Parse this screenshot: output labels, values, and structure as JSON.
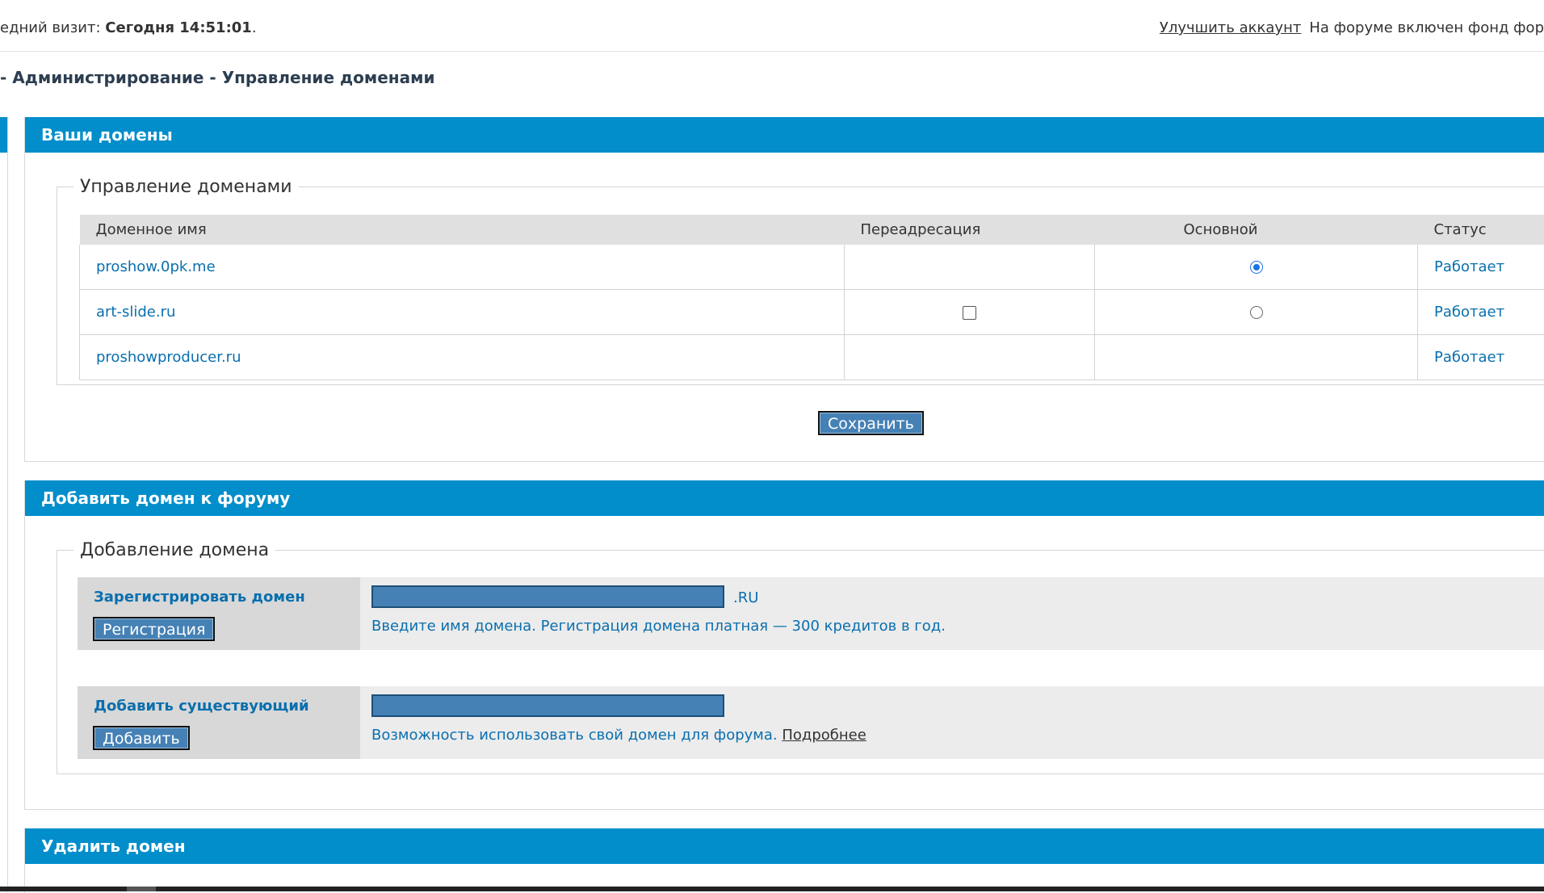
{
  "topbar": {
    "last_visit_label": "едний визит:",
    "last_visit_value": "Сегодня 14:51:01",
    "upgrade_link": "Улучшить аккаунт",
    "notice": "На форуме включен фонд фор"
  },
  "breadcrumb": "- Администрирование - Управление доменами",
  "your_domains": {
    "title": "Ваши домены",
    "legend": "Управление доменами",
    "columns": [
      "Доменное имя",
      "Переадресация",
      "Основной",
      "Статус"
    ],
    "rows": [
      {
        "domain": "proshow.0pk.me",
        "redirect": null,
        "primary": true,
        "status": "Работает"
      },
      {
        "domain": "art-slide.ru",
        "redirect": false,
        "primary": false,
        "status": "Работает"
      },
      {
        "domain": "proshowproducer.ru",
        "redirect": null,
        "primary": null,
        "status": "Работает"
      }
    ],
    "save_button": "Сохранить"
  },
  "add_domain": {
    "title": "Добавить домен к форуму",
    "legend": "Добавление домена",
    "register": {
      "label": "Зарегистрировать домен",
      "button": "Регистрация",
      "input_value": "",
      "suffix": ".RU",
      "hint": "Введите имя домена. Регистрация домена платная — 300 кредитов в год."
    },
    "existing": {
      "label": "Добавить существующий",
      "button": "Добавить",
      "input_value": "",
      "hint": "Возможность использовать свой домен для форума.",
      "hint_link": "Подробнее"
    }
  },
  "delete_domain": {
    "title": "Удалить домен"
  }
}
